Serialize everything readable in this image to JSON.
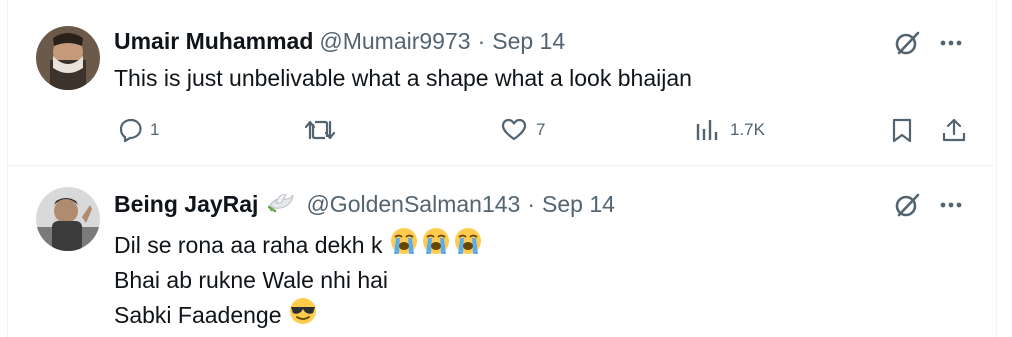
{
  "tweets": [
    {
      "name": "Umair Muhammad",
      "handle": "@Mumair9973",
      "separator": "·",
      "date": "Sep 14",
      "lines": [
        "This is just unbelivable what a shape what a look bhaijan"
      ],
      "replies": "1",
      "reposts": "",
      "likes": "7",
      "views": "1.7K"
    },
    {
      "name": "Being JayRaj",
      "handle": "@GoldenSalman143",
      "separator": "·",
      "date": "Sep 14",
      "lines": [
        "Dil se rona aa raha dekh k",
        "Bhai ab rukne Wale nhi hai",
        "Sabki Faadenge"
      ]
    }
  ],
  "colors": {
    "text": "#0f1419",
    "secondary": "#536471",
    "divider": "#eff3f4"
  },
  "icons": {
    "grok": "grok-icon",
    "more": "more-icon",
    "reply": "reply-icon",
    "repost": "repost-icon",
    "like": "like-icon",
    "views": "views-icon",
    "bookmark": "bookmark-icon",
    "share": "share-icon",
    "dove": "dove-emoji",
    "crying": "crying-emoji",
    "cool": "sunglasses-emoji"
  }
}
